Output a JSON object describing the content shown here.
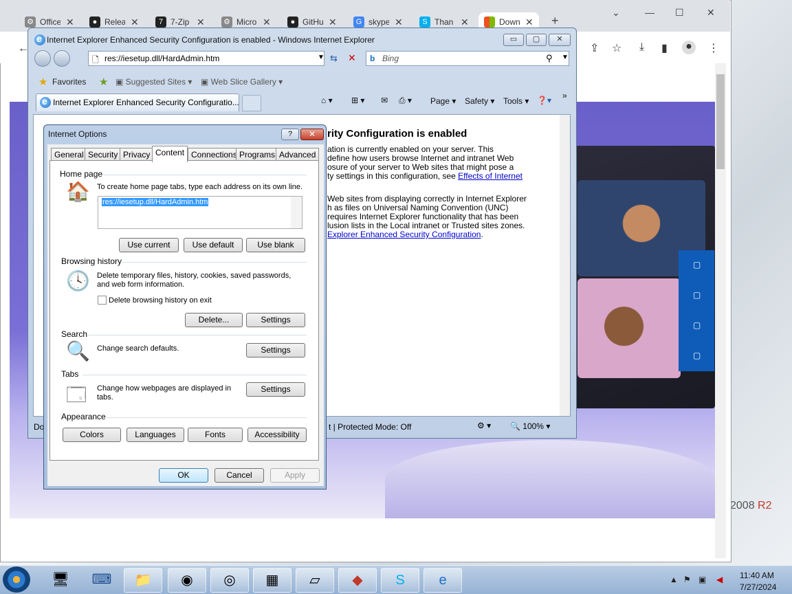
{
  "chrome": {
    "tabs": [
      {
        "label": "Office",
        "icon": "gear-icon"
      },
      {
        "label": "Relea",
        "icon": "github-icon"
      },
      {
        "label": "7-Zip",
        "icon": "7zip-icon"
      },
      {
        "label": "Micro",
        "icon": "gear-icon"
      },
      {
        "label": "GitHu",
        "icon": "github-icon"
      },
      {
        "label": "skype",
        "icon": "google-icon"
      },
      {
        "label": "Than",
        "icon": "skype-icon"
      },
      {
        "label": "Down",
        "icon": "microsoft-icon"
      }
    ],
    "new_tab": "+",
    "close_glyph": "✕",
    "wallpaper_text": "2008",
    "wallpaper_text_r2": "R2"
  },
  "ie": {
    "title": "Internet Explorer Enhanced Security Configuration is enabled - Windows Internet Explorer",
    "address": "res://iesetup.dll/HardAdmin.htm",
    "search_placeholder": "Bing",
    "favorites": "Favorites",
    "suggested_sites": "Suggested Sites",
    "web_slice_gallery": "Web Slice Gallery",
    "tab_title": "Internet Explorer Enhanced Security Configuratio...",
    "commands": {
      "page": "Page",
      "safety": "Safety",
      "tools": "Tools"
    },
    "page_heading": "rity Configuration is enabled",
    "page_lines": [
      "ation is currently enabled on your server. This",
      "define how users browse Internet and intranet Web",
      "osure of your server to Web sites that might pose a",
      "ty settings in this configuration, see",
      "Web sites from displaying correctly in Internet Explorer",
      "h as files on Universal Naming Convention (UNC)",
      "requires Internet Explorer functionality that has been",
      "lusion lists in the Local intranet or Trusted sites zones."
    ],
    "link1": "Effects of Internet",
    "link2": "Explorer Enhanced Security Configuration",
    "link2_suffix": ".",
    "status_left": "Do",
    "status_mode": "t | Protected Mode: Off",
    "zoom": "100%"
  },
  "dialog": {
    "title": "Internet Options",
    "help": "?",
    "close": "✕",
    "tabs": [
      "General",
      "Security",
      "Privacy",
      "Content",
      "Connections",
      "Programs",
      "Advanced"
    ],
    "selected_tab": "Content",
    "home_page": {
      "section": "Home page",
      "instruction": "To create home page tabs, type each address on its own line.",
      "value": "res://iesetup.dll/HardAdmin.htm",
      "use_current": "Use current",
      "use_default": "Use default",
      "use_blank": "Use blank"
    },
    "browsing_history": {
      "section": "Browsing history",
      "desc1": "Delete temporary files, history, cookies, saved passwords,",
      "desc2": "and web form information.",
      "checkbox": "Delete browsing history on exit",
      "delete": "Delete...",
      "settings": "Settings"
    },
    "search": {
      "section": "Search",
      "desc": "Change search defaults.",
      "settings": "Settings"
    },
    "tabs_section": {
      "section": "Tabs",
      "desc1": "Change how webpages are displayed in",
      "desc2": "tabs.",
      "settings": "Settings"
    },
    "appearance": {
      "section": "Appearance",
      "colors": "Colors",
      "languages": "Languages",
      "fonts": "Fonts",
      "accessibility": "Accessibility"
    },
    "ok": "OK",
    "cancel": "Cancel",
    "apply": "Apply"
  },
  "taskbar": {
    "time": "11:40 AM",
    "date": "7/27/2024"
  }
}
